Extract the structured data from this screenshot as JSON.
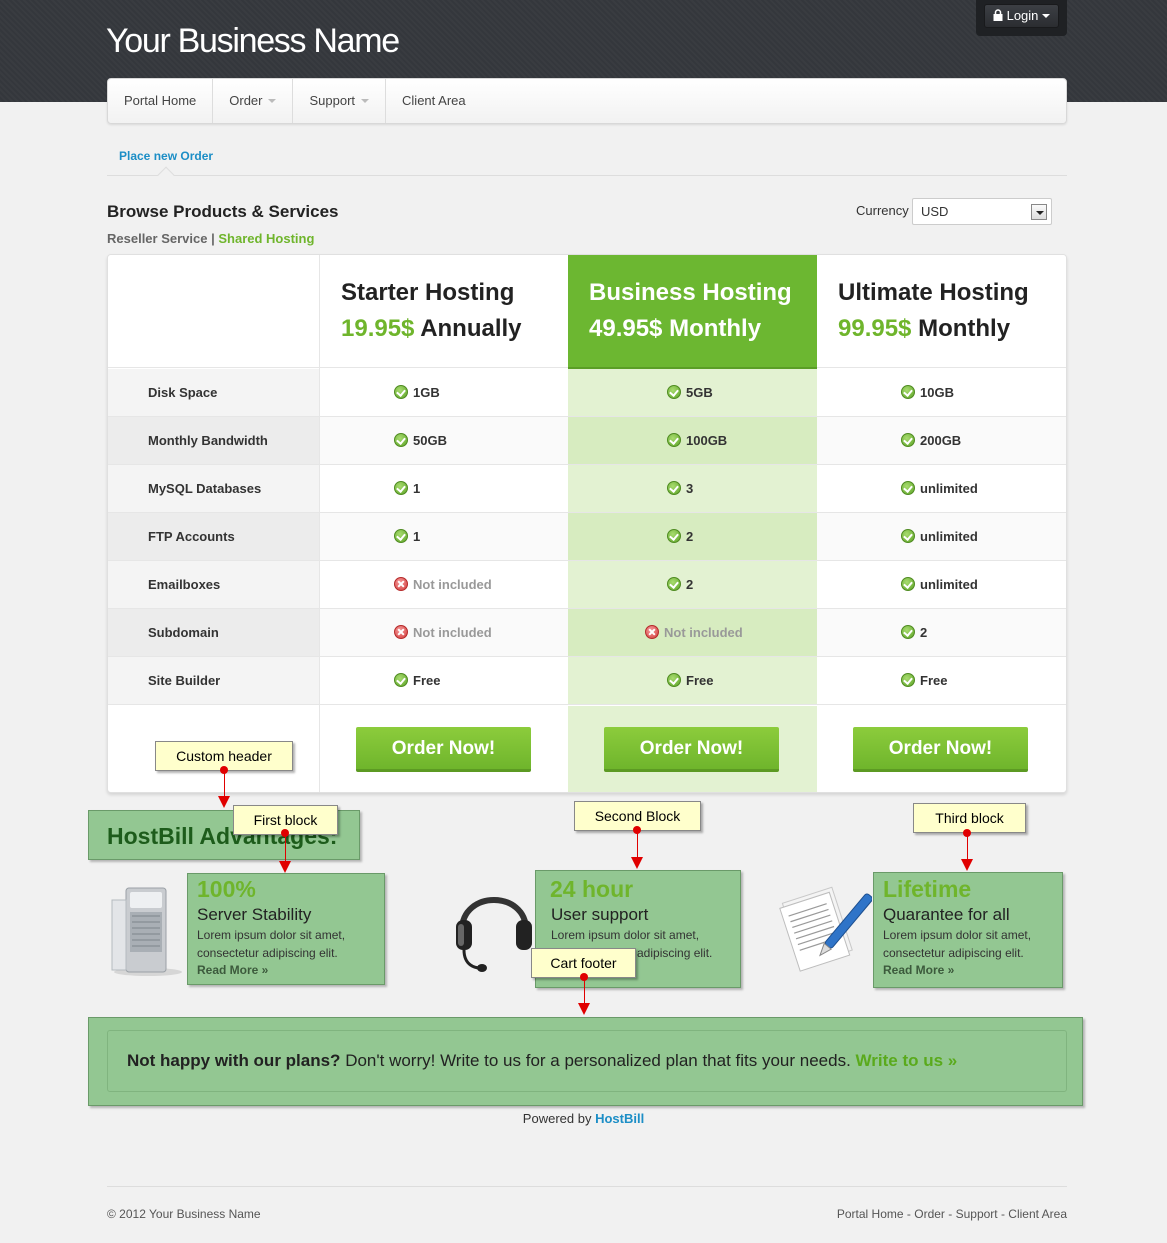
{
  "header": {
    "brand": "Your Business Name",
    "login_label": "Login"
  },
  "nav": {
    "items": [
      {
        "label": "Portal Home"
      },
      {
        "label": "Order"
      },
      {
        "label": "Support"
      },
      {
        "label": "Client Area"
      }
    ]
  },
  "subnav": {
    "active": "Place new Order"
  },
  "browse": {
    "title": "Browse Products & Services",
    "categories": [
      "Reseller Service",
      "Shared Hosting"
    ],
    "separator": "|",
    "currency_label": "Currency",
    "currency_value": "USD"
  },
  "pricing": {
    "features": [
      "Disk Space",
      "Monthly Bandwidth",
      "MySQL Databases",
      "FTP Accounts",
      "Emailboxes",
      "Subdomain",
      "Site Builder"
    ],
    "plans": [
      {
        "name": "Starter Hosting",
        "price": "19.95$",
        "period": "Annually",
        "values": [
          {
            "text": "1GB",
            "ok": true
          },
          {
            "text": "50GB",
            "ok": true
          },
          {
            "text": "1",
            "ok": true
          },
          {
            "text": "1",
            "ok": true
          },
          {
            "text": "Not included",
            "ok": false
          },
          {
            "text": "Not included",
            "ok": false
          },
          {
            "text": "Free",
            "ok": true
          }
        ],
        "button": "Order Now!"
      },
      {
        "name": "Business Hosting",
        "price": "49.95$",
        "period": "Monthly",
        "highlighted": true,
        "values": [
          {
            "text": "5GB",
            "ok": true
          },
          {
            "text": "100GB",
            "ok": true
          },
          {
            "text": "3",
            "ok": true
          },
          {
            "text": "2",
            "ok": true
          },
          {
            "text": "2",
            "ok": true
          },
          {
            "text": "Not included",
            "ok": false
          },
          {
            "text": "Free",
            "ok": true
          }
        ],
        "button": "Order Now!"
      },
      {
        "name": "Ultimate Hosting",
        "price": "99.95$",
        "period": "Monthly",
        "values": [
          {
            "text": "10GB",
            "ok": true
          },
          {
            "text": "200GB",
            "ok": true
          },
          {
            "text": "unlimited",
            "ok": true
          },
          {
            "text": "unlimited",
            "ok": true
          },
          {
            "text": "unlimited",
            "ok": true
          },
          {
            "text": "2",
            "ok": true
          },
          {
            "text": "Free",
            "ok": true
          }
        ],
        "button": "Order Now!"
      }
    ]
  },
  "advantages": {
    "title": "HostBill Advantages:",
    "blocks": [
      {
        "big": "100%",
        "sub": "Server Stability",
        "desc1": "Lorem ipsum dolor sit amet,",
        "desc2": "consectetur adipiscing elit.",
        "more": "Read More »"
      },
      {
        "big": "24 hour",
        "sub": "User support",
        "desc1": "Lorem ipsum dolor sit amet,",
        "desc2": "adipiscing elit.",
        "more": ""
      },
      {
        "big": "Lifetime",
        "sub": "Quarantee for all",
        "desc1": "Lorem ipsum dolor sit amet,",
        "desc2": "consectetur adipiscing elit.",
        "more": "Read More »"
      }
    ]
  },
  "annotations": {
    "custom_header": "Custom header",
    "first_block": "First block",
    "second_block": "Second Block",
    "third_block": "Third block",
    "cart_footer": "Cart footer"
  },
  "cta": {
    "bold": "Not happy with our plans?",
    "text": "Don't worry! Write to us for a personalized plan that fits your needs.",
    "link": "Write to us »"
  },
  "powered": {
    "prefix": "Powered by",
    "link": "HostBill"
  },
  "footer": {
    "copyright": "© 2012 Your Business Name",
    "links": [
      "Portal Home",
      "Order",
      "Support",
      "Client Area"
    ],
    "link_separator": " - "
  },
  "colors": {
    "accent_green": "#6cb731",
    "link_blue": "#1c8ec6",
    "annotation_green": "#93c792",
    "topbar": "#34373c"
  }
}
